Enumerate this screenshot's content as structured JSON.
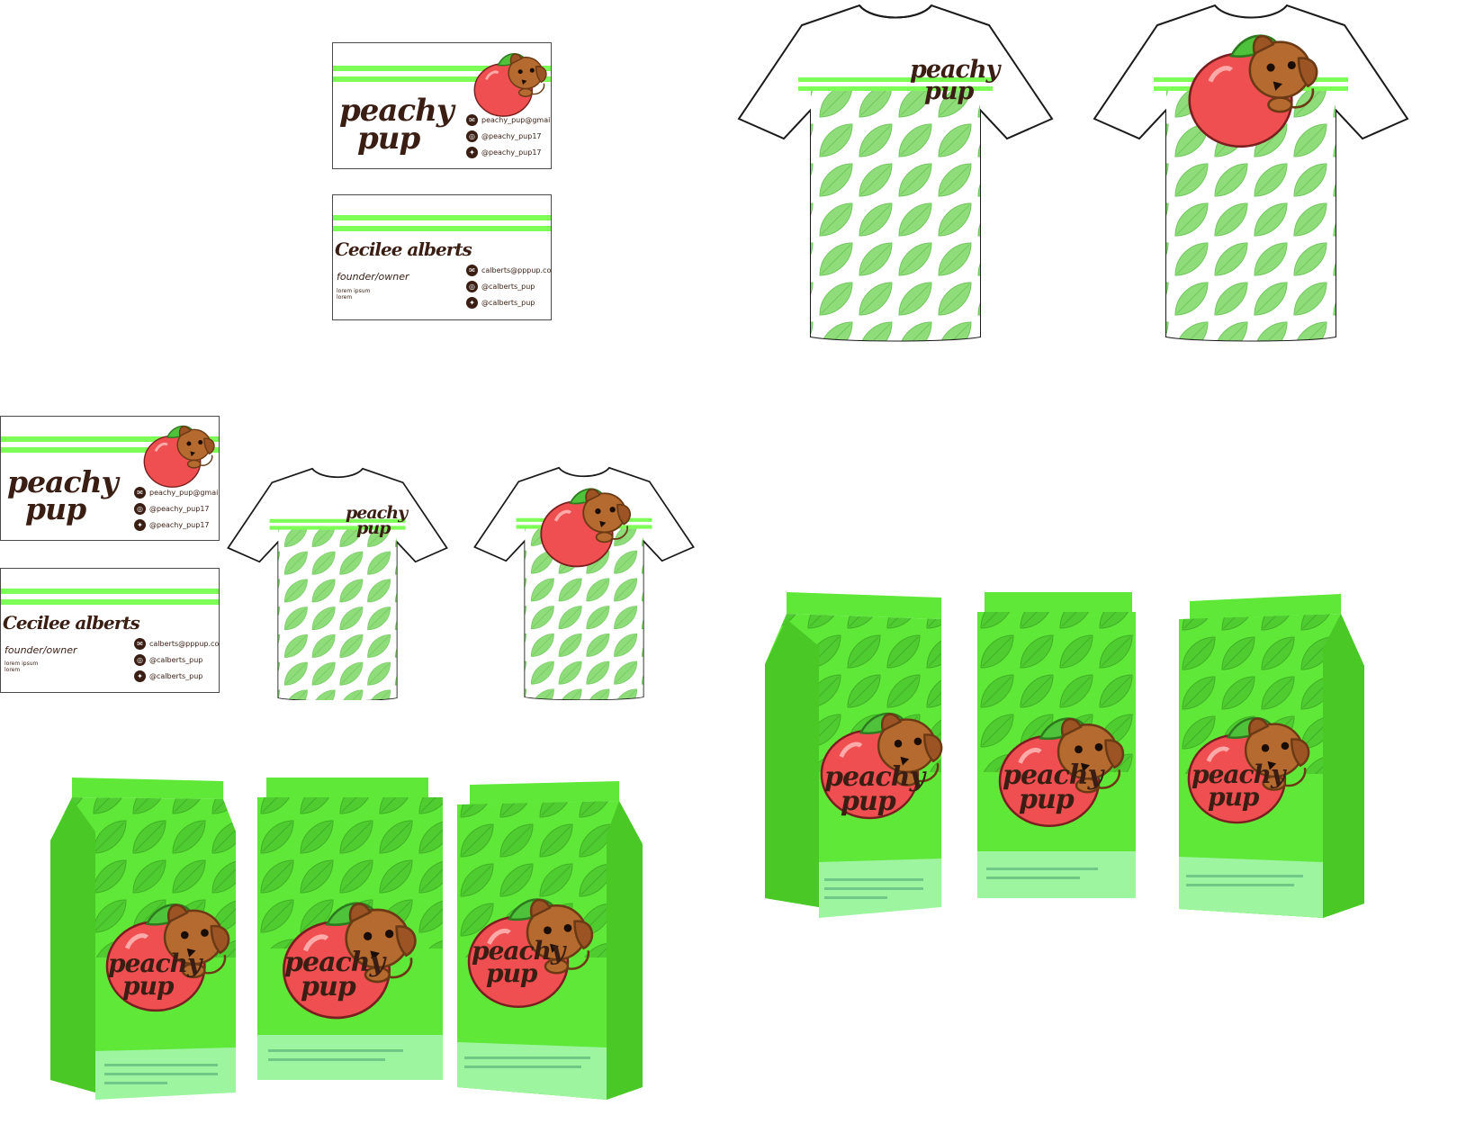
{
  "brand": {
    "name_line1": "peachy",
    "name_line2": "pup"
  },
  "card_front": {
    "contacts": [
      {
        "icon": "email-icon",
        "text": "peachy_pup@gmail.com"
      },
      {
        "icon": "instagram-icon",
        "text": "@peachy_pup17"
      },
      {
        "icon": "twitter-icon",
        "text": "@peachy_pup17"
      }
    ]
  },
  "card_back": {
    "person_name": "Cecilee alberts",
    "role": "founder/owner",
    "lorem1": "lorem ipsum",
    "lorem2": "lorem",
    "contacts": [
      {
        "icon": "email-icon",
        "text": "calberts@pppup.com"
      },
      {
        "icon": "instagram-icon",
        "text": "@calberts_pup"
      },
      {
        "icon": "twitter-icon",
        "text": "@calberts_pup"
      }
    ]
  },
  "colors": {
    "stripe_green": "#7dff57",
    "bag_green": "#5fe838",
    "leaf_green": "#8fdc7a",
    "peach_red": "#ef4f50",
    "pup_brown": "#b56a2f",
    "ink_brown": "#3a1e14"
  }
}
